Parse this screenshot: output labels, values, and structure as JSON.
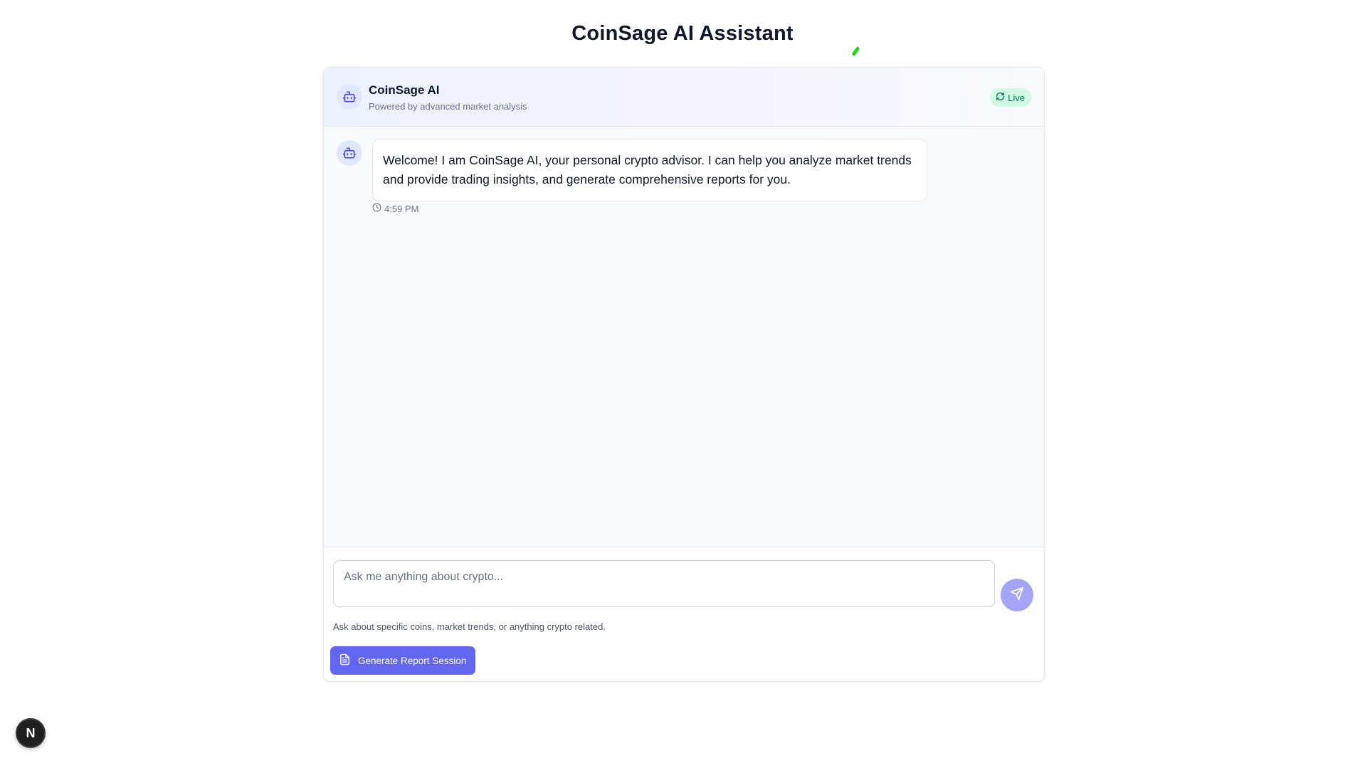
{
  "page": {
    "title": "CoinSage AI Assistant"
  },
  "header": {
    "name": "CoinSage AI",
    "subtitle": "Powered by advanced market analysis",
    "status_label": "Live",
    "avatar_icon": "bot-icon",
    "status_icon": "refresh-icon"
  },
  "messages": [
    {
      "sender_icon": "bot-icon",
      "text": "Welcome! I am CoinSage AI, your personal crypto advisor. I can help you analyze market trends and provide trading insights, and generate comprehensive reports for you.",
      "time": "4:59 PM",
      "time_icon": "clock-icon"
    }
  ],
  "composer": {
    "placeholder": "Ask me anything about crypto...",
    "value": "",
    "hint": "Ask about specific coins, market trends, or anything crypto related.",
    "send_icon": "send-icon"
  },
  "actions": {
    "report_label": "Generate Report Session",
    "report_icon": "document-icon"
  },
  "dev_badge": {
    "label": "N"
  },
  "colors": {
    "accent": "#6366f1",
    "send_button": "#a5a4f7",
    "live_bg": "#d1fae5",
    "live_text": "#047857",
    "avatar_bg": "#e0e7ff"
  }
}
